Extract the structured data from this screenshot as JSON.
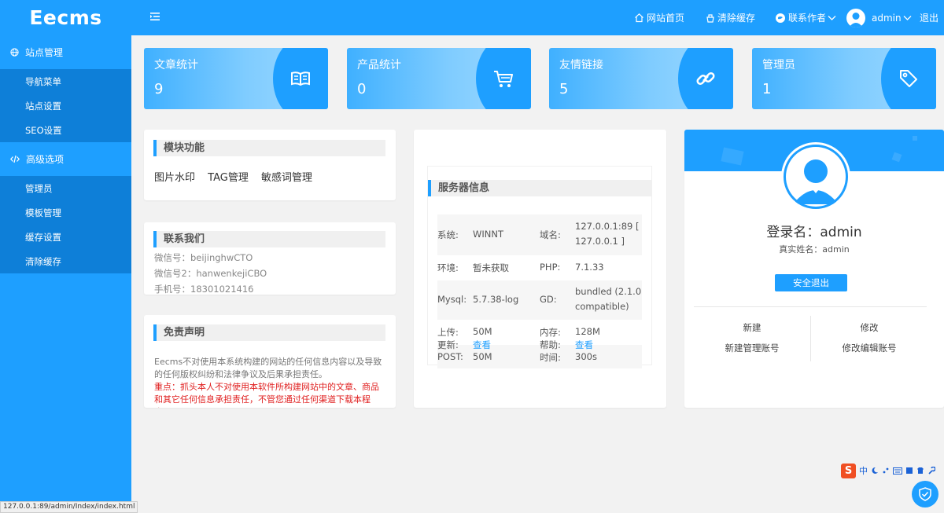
{
  "app": {
    "logo": "Eecms"
  },
  "header": {
    "site_home": "网站首页",
    "clear_cache": "清除缓存",
    "contact_author": "联系作者",
    "user": "admin",
    "logout": "退出"
  },
  "sidebar": {
    "groups": [
      {
        "title": "站点管理",
        "items": [
          "导航菜单",
          "站点设置",
          "SEO设置"
        ]
      },
      {
        "title": "高级选项",
        "items": [
          "管理员",
          "模板管理",
          "缓存设置",
          "清除缓存"
        ]
      }
    ]
  },
  "stats": [
    {
      "title": "文章统计",
      "value": "9",
      "icon": "book-icon"
    },
    {
      "title": "产品统计",
      "value": "0",
      "icon": "cart-icon"
    },
    {
      "title": "友情链接",
      "value": "5",
      "icon": "link-icon"
    },
    {
      "title": "管理员",
      "value": "1",
      "icon": "tag-icon"
    }
  ],
  "modules": {
    "title": "模块功能",
    "links": [
      "图片水印",
      "TAG管理",
      "敏感词管理"
    ]
  },
  "contact": {
    "title": "联系我们",
    "lines": [
      "微信号：beijinghwCTO",
      "微信号2：hanwenkejiCBO",
      "手机号：18301021416"
    ]
  },
  "disclaimer": {
    "title": "免责声明",
    "text": "Eecms不对使用本系统构建的网站的任何信息内容以及导致的任何版权纠纷和法律争议及后果承担责任。",
    "warning": "重点：抓头本人不对使用本软件所构建网站中的文章、商品和其它任何信息承担责任，不管您通过任何渠道下载本程序，"
  },
  "server": {
    "title": "服务器信息",
    "rows": [
      {
        "k1": "系统:",
        "v1": "WINNT",
        "k2": "域名:",
        "v2a": "127.0.0.1:89 [",
        "v2b": "127.0.0.1 ]"
      },
      {
        "k1": "环境:",
        "v1": "暂未获取",
        "k2": "PHP:",
        "v2": "7.1.33"
      },
      {
        "k1": "Mysql:",
        "v1": "5.7.38-log",
        "k2": "GD:",
        "v2a": "bundled (2.1.0",
        "v2b": "compatible)"
      },
      {
        "k1": "上传:",
        "v1": "50M",
        "k2": "内存:",
        "v2": "128M"
      },
      {
        "k1": "POST:",
        "v1": "50M",
        "k2": "时间:",
        "v2": "300s"
      },
      {
        "k1": "更新:",
        "v1": "查看",
        "k2": "帮助:",
        "v2": "查看"
      }
    ]
  },
  "profile": {
    "login_label": "登录名：admin",
    "real_label": "真实姓名：admin",
    "logout_btn": "安全退出",
    "new_title": "新建",
    "new_sub": "新建管理账号",
    "edit_title": "修改",
    "edit_sub": "修改编辑账号"
  },
  "statusbar": "127.0.0.1:89/admin/Index/index.html",
  "ime": {
    "label": "中"
  },
  "colors": {
    "primary": "#1e9fff",
    "sidebar_sub": "#0e7fd8",
    "warning": "#e02020"
  }
}
